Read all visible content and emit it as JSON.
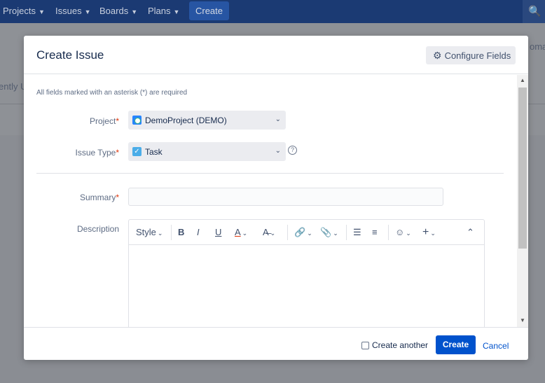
{
  "topnav": {
    "items": [
      {
        "label": "Projects"
      },
      {
        "label": "Issues"
      },
      {
        "label": "Boards"
      },
      {
        "label": "Plans"
      }
    ],
    "create_label": "Create",
    "search_glyph": "🔍"
  },
  "background": {
    "left_text": "ently U",
    "right_text": "omain"
  },
  "modal": {
    "title": "Create Issue",
    "configure_fields_label": "Configure Fields",
    "required_note": "All fields marked with an asterisk (*) are required",
    "fields": {
      "project": {
        "label": "Project",
        "value": "DemoProject (DEMO)"
      },
      "issue_type": {
        "label": "Issue Type",
        "value": "Task"
      },
      "summary": {
        "label": "Summary",
        "value": ""
      },
      "description": {
        "label": "Description"
      }
    },
    "required_marker": "*",
    "toolbar": {
      "style_label": "Style",
      "bold": "B",
      "italic": "I",
      "underline": "U",
      "text_color": "A",
      "clear_format": "A̶"
    },
    "footer": {
      "create_another_label": "Create another",
      "create_label": "Create",
      "cancel_label": "Cancel"
    }
  },
  "colors": {
    "accent": "#0052cc",
    "nav_bg": "#1b3a73",
    "required": "#de350b"
  }
}
